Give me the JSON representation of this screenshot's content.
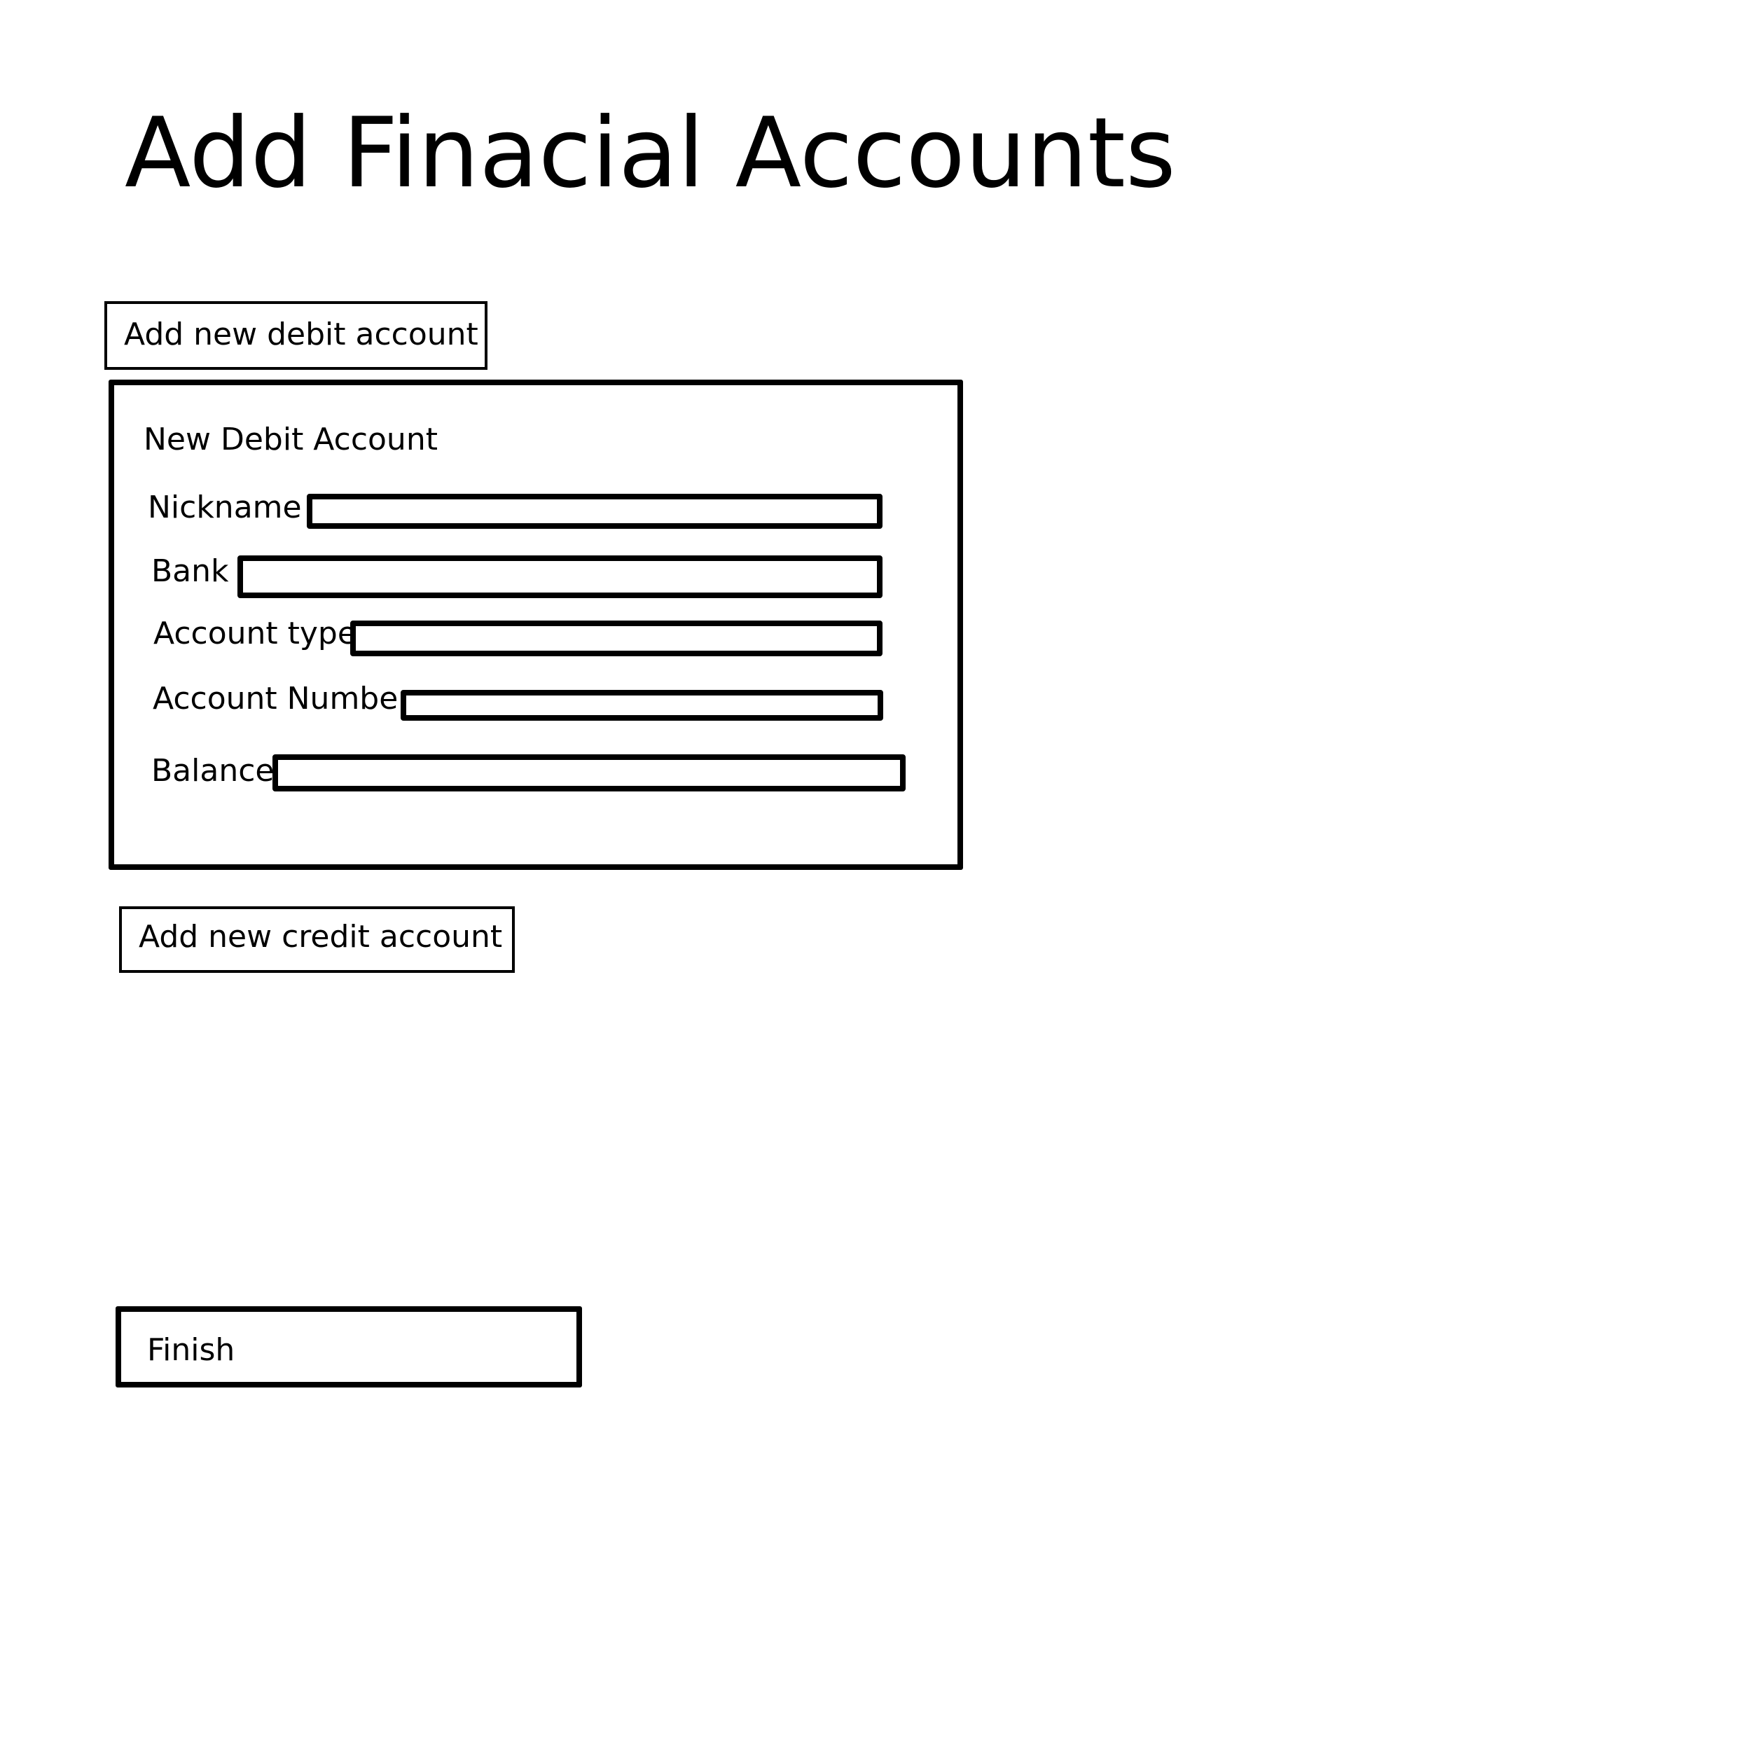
{
  "page": {
    "title": "Add Finacial Accounts"
  },
  "debit": {
    "add_button_label": "Add new debit account",
    "panel_title": "New Debit Account",
    "fields": [
      {
        "label": "Nickname",
        "value": ""
      },
      {
        "label": "Bank",
        "value": ""
      },
      {
        "label": "Account type",
        "value": ""
      },
      {
        "label": "Account Number",
        "value": ""
      },
      {
        "label": "Balance",
        "value": ""
      }
    ]
  },
  "credit": {
    "add_button_label": "Add new credit account"
  },
  "actions": {
    "finish_label": "Finish"
  }
}
